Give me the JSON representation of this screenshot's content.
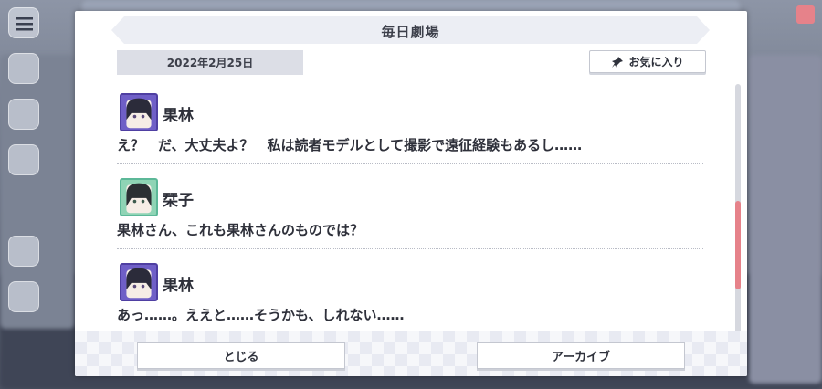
{
  "dialog": {
    "title": "毎日劇場",
    "date": "2022年2月25日",
    "favorite_label": "お気に入り"
  },
  "entries": [
    {
      "speaker": "果林",
      "avatar": "purple",
      "text": "え？　だ、大丈夫よ？　私は読者モデルとして撮影で遠征経験もあるし……"
    },
    {
      "speaker": "栞子",
      "avatar": "green",
      "text": "果林さん、これも果林さんのものでは？"
    },
    {
      "speaker": "果林",
      "avatar": "purple",
      "text": "あっ……。ええと……そうかも、しれない……"
    }
  ],
  "footer": {
    "close_label": "とじる",
    "archive_label": "アーカイブ"
  },
  "colors": {
    "scroll_thumb": "#e6828a",
    "title_bar": "#eceef4",
    "avatar_purple": "#6f5fc7",
    "avatar_green": "#8fd4b5"
  },
  "icons": [
    "menu-icon",
    "pin-icon"
  ]
}
